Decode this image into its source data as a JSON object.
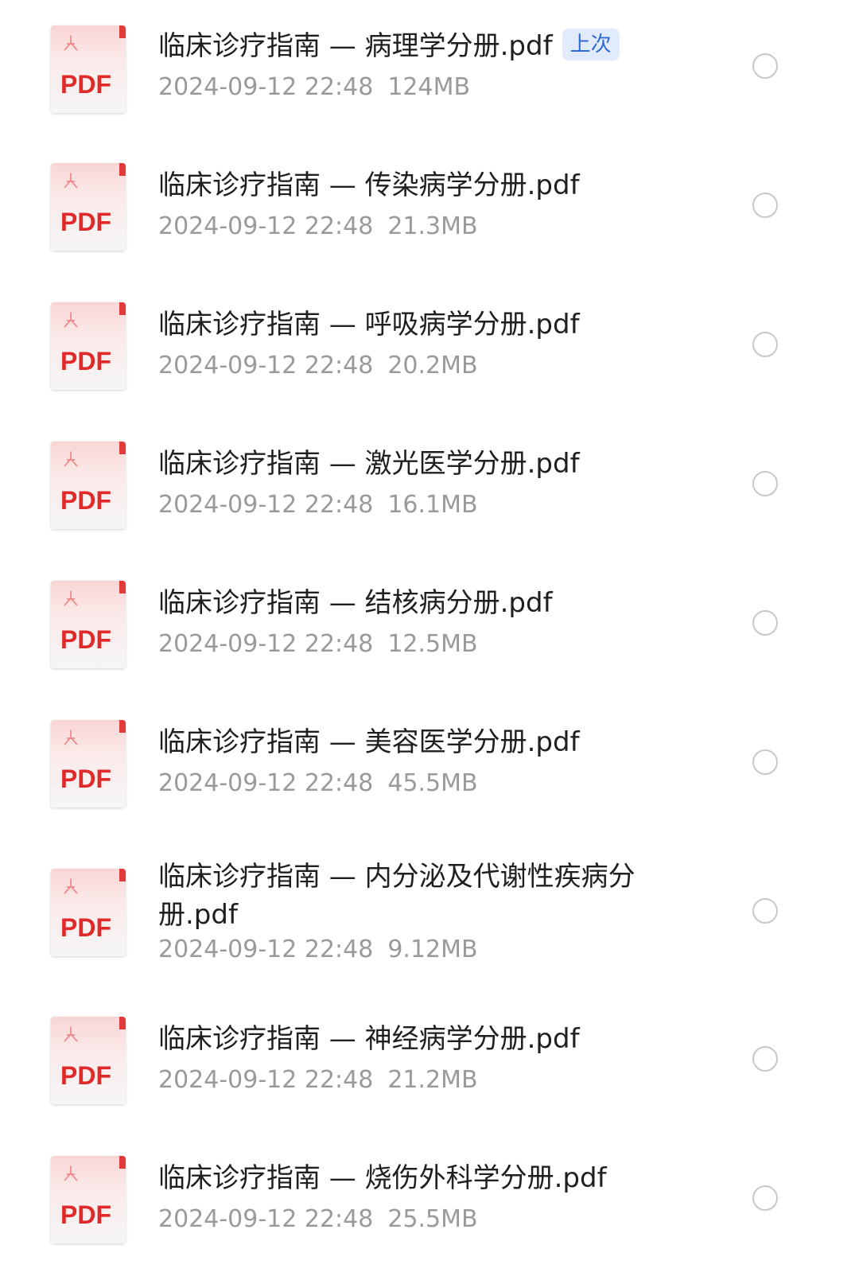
{
  "file_list": {
    "items": [
      {
        "name": "临床诊疗指南 — 病理学分册.pdf",
        "date": "2024-09-12 22:48",
        "size": "124MB",
        "badge": "上次"
      },
      {
        "name": "临床诊疗指南 — 传染病学分册.pdf",
        "date": "2024-09-12 22:48",
        "size": "21.3MB"
      },
      {
        "name": "临床诊疗指南 — 呼吸病学分册.pdf",
        "date": "2024-09-12 22:48",
        "size": "20.2MB"
      },
      {
        "name": "临床诊疗指南 — 激光医学分册.pdf",
        "date": "2024-09-12 22:48",
        "size": "16.1MB"
      },
      {
        "name": "临床诊疗指南 — 结核病分册.pdf",
        "date": "2024-09-12 22:48",
        "size": "12.5MB"
      },
      {
        "name": "临床诊疗指南 — 美容医学分册.pdf",
        "date": "2024-09-12 22:48",
        "size": "45.5MB"
      },
      {
        "name": "临床诊疗指南 — 内分泌及代谢性疾病分册.pdf",
        "date": "2024-09-12 22:48",
        "size": "9.12MB"
      },
      {
        "name": "临床诊疗指南 — 神经病学分册.pdf",
        "date": "2024-09-12 22:48",
        "size": "21.2MB"
      },
      {
        "name": "临床诊疗指南 — 烧伤外科学分册.pdf",
        "date": "2024-09-12 22:48",
        "size": "25.5MB"
      }
    ],
    "icon": {
      "type": "pdf-file-icon",
      "label": "PDF",
      "accent": "#e02a2a"
    },
    "colors": {
      "name": "#1f1f1f",
      "meta": "#9a9a9a",
      "badge_bg": "#e1ebfb",
      "badge_text": "#2e6ad6"
    }
  }
}
